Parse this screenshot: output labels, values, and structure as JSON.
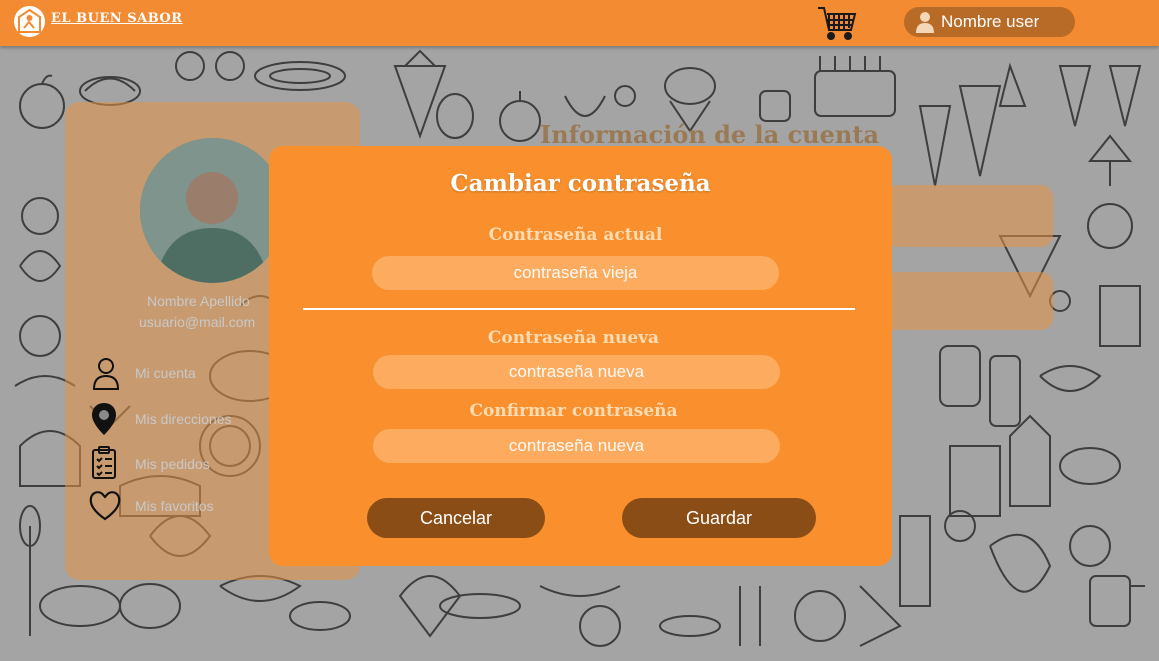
{
  "header": {
    "brand": "EL BUEN SABOR",
    "user_name": "Nombre user",
    "icons": [
      "chef-logo-icon",
      "cart-icon",
      "user-icon"
    ]
  },
  "account_page": {
    "section_title": "Información de la cuenta",
    "profile_name": "Nombre Apellido",
    "profile_email": "usuario@mail.com",
    "menu": [
      {
        "label": "Mi cuenta",
        "icon": "user-outline-icon"
      },
      {
        "label": "Mis direcciones",
        "icon": "location-pin-icon"
      },
      {
        "label": "Mis pedidos",
        "icon": "clipboard-list-icon"
      },
      {
        "label": "Mis favoritos",
        "icon": "heart-icon"
      }
    ]
  },
  "modal": {
    "title": "Cambiar contraseña",
    "current_label": "Contraseña actual",
    "current_placeholder": "contraseña vieja",
    "new_label": "Contraseña nueva",
    "new_placeholder": "contraseña nueva",
    "confirm_label": "Confirmar contraseña",
    "confirm_placeholder": "contraseña nueva",
    "cancel_label": "Cancelar",
    "save_label": "Guardar"
  },
  "colors": {
    "header": "#f28b31",
    "modal": "#f9902d",
    "field": "#fdab5e",
    "button": "#8b4d16",
    "user_pill": "#b86b27"
  }
}
